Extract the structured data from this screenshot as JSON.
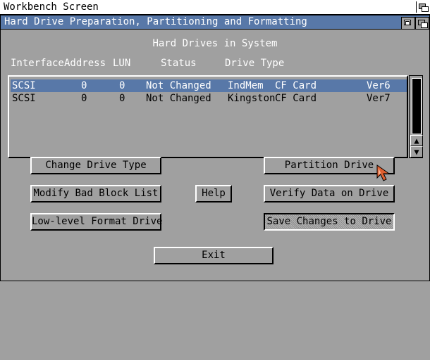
{
  "screen": {
    "title": "Workbench Screen"
  },
  "window": {
    "title": "Hard Drive Preparation, Partitioning and Formatting"
  },
  "section_title": "Hard Drives in System",
  "columns": {
    "interface": "Interface",
    "address": "Address",
    "lun": "LUN",
    "status": "Status",
    "drive_type": "Drive Type"
  },
  "drives": [
    {
      "interface": "SCSI",
      "address": "0",
      "lun": "0",
      "status": "Not Changed",
      "vendor": "IndMem",
      "model": "CF Card",
      "revision": "Ver6"
    },
    {
      "interface": "SCSI",
      "address": "0",
      "lun": "0",
      "status": "Not Changed",
      "vendor": "Kingston",
      "model": "CF Card",
      "revision": "Ver7"
    }
  ],
  "buttons": {
    "change_drive_type": "Change Drive Type",
    "modify_bad_block": "Modify Bad Block List",
    "low_level_format": "Low-level Format Drive",
    "help": "Help",
    "partition_drive": "Partition Drive",
    "verify_data": "Verify Data on Drive",
    "save_changes": "Save Changes to Drive",
    "exit": "Exit"
  },
  "scroll": {
    "up_glyph": "▲",
    "down_glyph": "▼"
  },
  "colors": {
    "accent": "#5878a8",
    "background": "#a0a0a0",
    "highlight_text": "#ffffff"
  },
  "icons": [
    "depth-gadget-icon",
    "zoom-gadget-icon",
    "mouse-pointer-icon",
    "scroll-up-arrow-icon",
    "scroll-down-arrow-icon"
  ]
}
